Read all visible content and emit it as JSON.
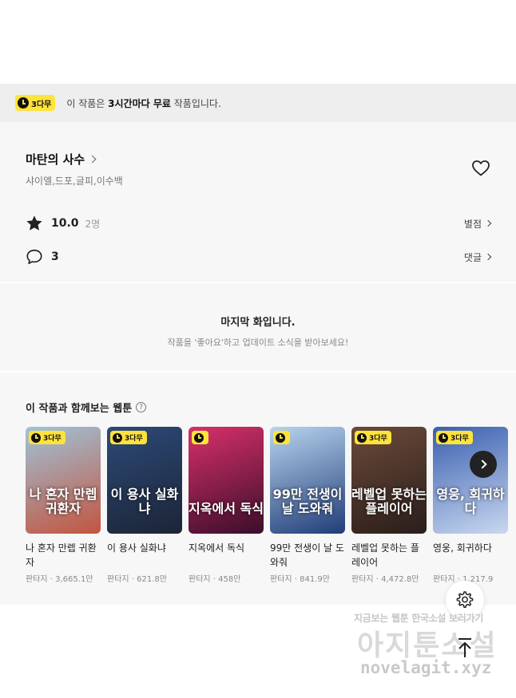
{
  "banner": {
    "badge": "3다무",
    "text_prefix": "이 작품은 ",
    "text_bold": "3시간마다 무료",
    "text_suffix": " 작품입니다."
  },
  "work": {
    "title": "마탄의 사수",
    "authors": "샤이엘,드포,글피,이수백",
    "rating": "10.0",
    "rating_count": "2명",
    "rating_link": "별점",
    "comment_count": "3",
    "comment_link": "댓글"
  },
  "last_episode": {
    "heading": "마지막 화입니다.",
    "subtext": "작품을 '좋아요'하고 업데이트 소식을 받아보세요!"
  },
  "recommendations": {
    "title": "이 작품과 함께보는 웹툰",
    "help": "?",
    "items": [
      {
        "badge": "3다무",
        "cover_title": "나 혼자 만렙 귀환자",
        "name": "나 혼자 만렙 귀환자",
        "meta": "판타지 · 3,665.1만",
        "color_top": "#9fc3d9",
        "color_bottom": "#c2553f"
      },
      {
        "badge": "3다무",
        "cover_title": "이 용사 실화냐",
        "name": "이 용사 실화냐",
        "meta": "판타지 · 621.8만",
        "color_top": "#2c4a78",
        "color_bottom": "#1d2436"
      },
      {
        "badge": "",
        "cover_title": "지옥에서 독식",
        "name": "지옥에서 독식",
        "meta": "판타지 · 458만",
        "color_top": "#d8306a",
        "color_bottom": "#3a0e2a"
      },
      {
        "badge": "",
        "cover_title": "99만 전생이 날 도와줘",
        "name": "99만 전생이 날 도와줘",
        "meta": "판타지 · 841.9만",
        "color_top": "#b8d4ef",
        "color_bottom": "#213d78"
      },
      {
        "badge": "3다무",
        "cover_title": "레벨업 못하는 플레이어",
        "name": "레벨업 못하는 플레이어",
        "meta": "판타지 · 4,472.8만",
        "color_top": "#6b4a3a",
        "color_bottom": "#2a1e1a"
      },
      {
        "badge": "3다무",
        "cover_title": "영웅, 회귀하다",
        "name": "영웅, 회귀하다",
        "meta": "판타지 · 1,217.9",
        "color_top": "#3a5fb0",
        "color_bottom": "#c9d8f0"
      }
    ]
  },
  "watermark": {
    "line1": "지금보는 웹툰 한국소설 보러가기",
    "line2": "아지툰소설",
    "line3": "novelagit.xyz"
  },
  "icons": {
    "heart": "heart-icon",
    "star": "star-icon",
    "comment": "comment-icon",
    "gear": "gear-icon",
    "arrow_up": "arrow-up-icon",
    "next": "chevron-right-icon"
  },
  "colors": {
    "badge_yellow": "#ffe33a",
    "panel_bg": "#f7f7f7",
    "banner_bg": "#eeeeee"
  }
}
